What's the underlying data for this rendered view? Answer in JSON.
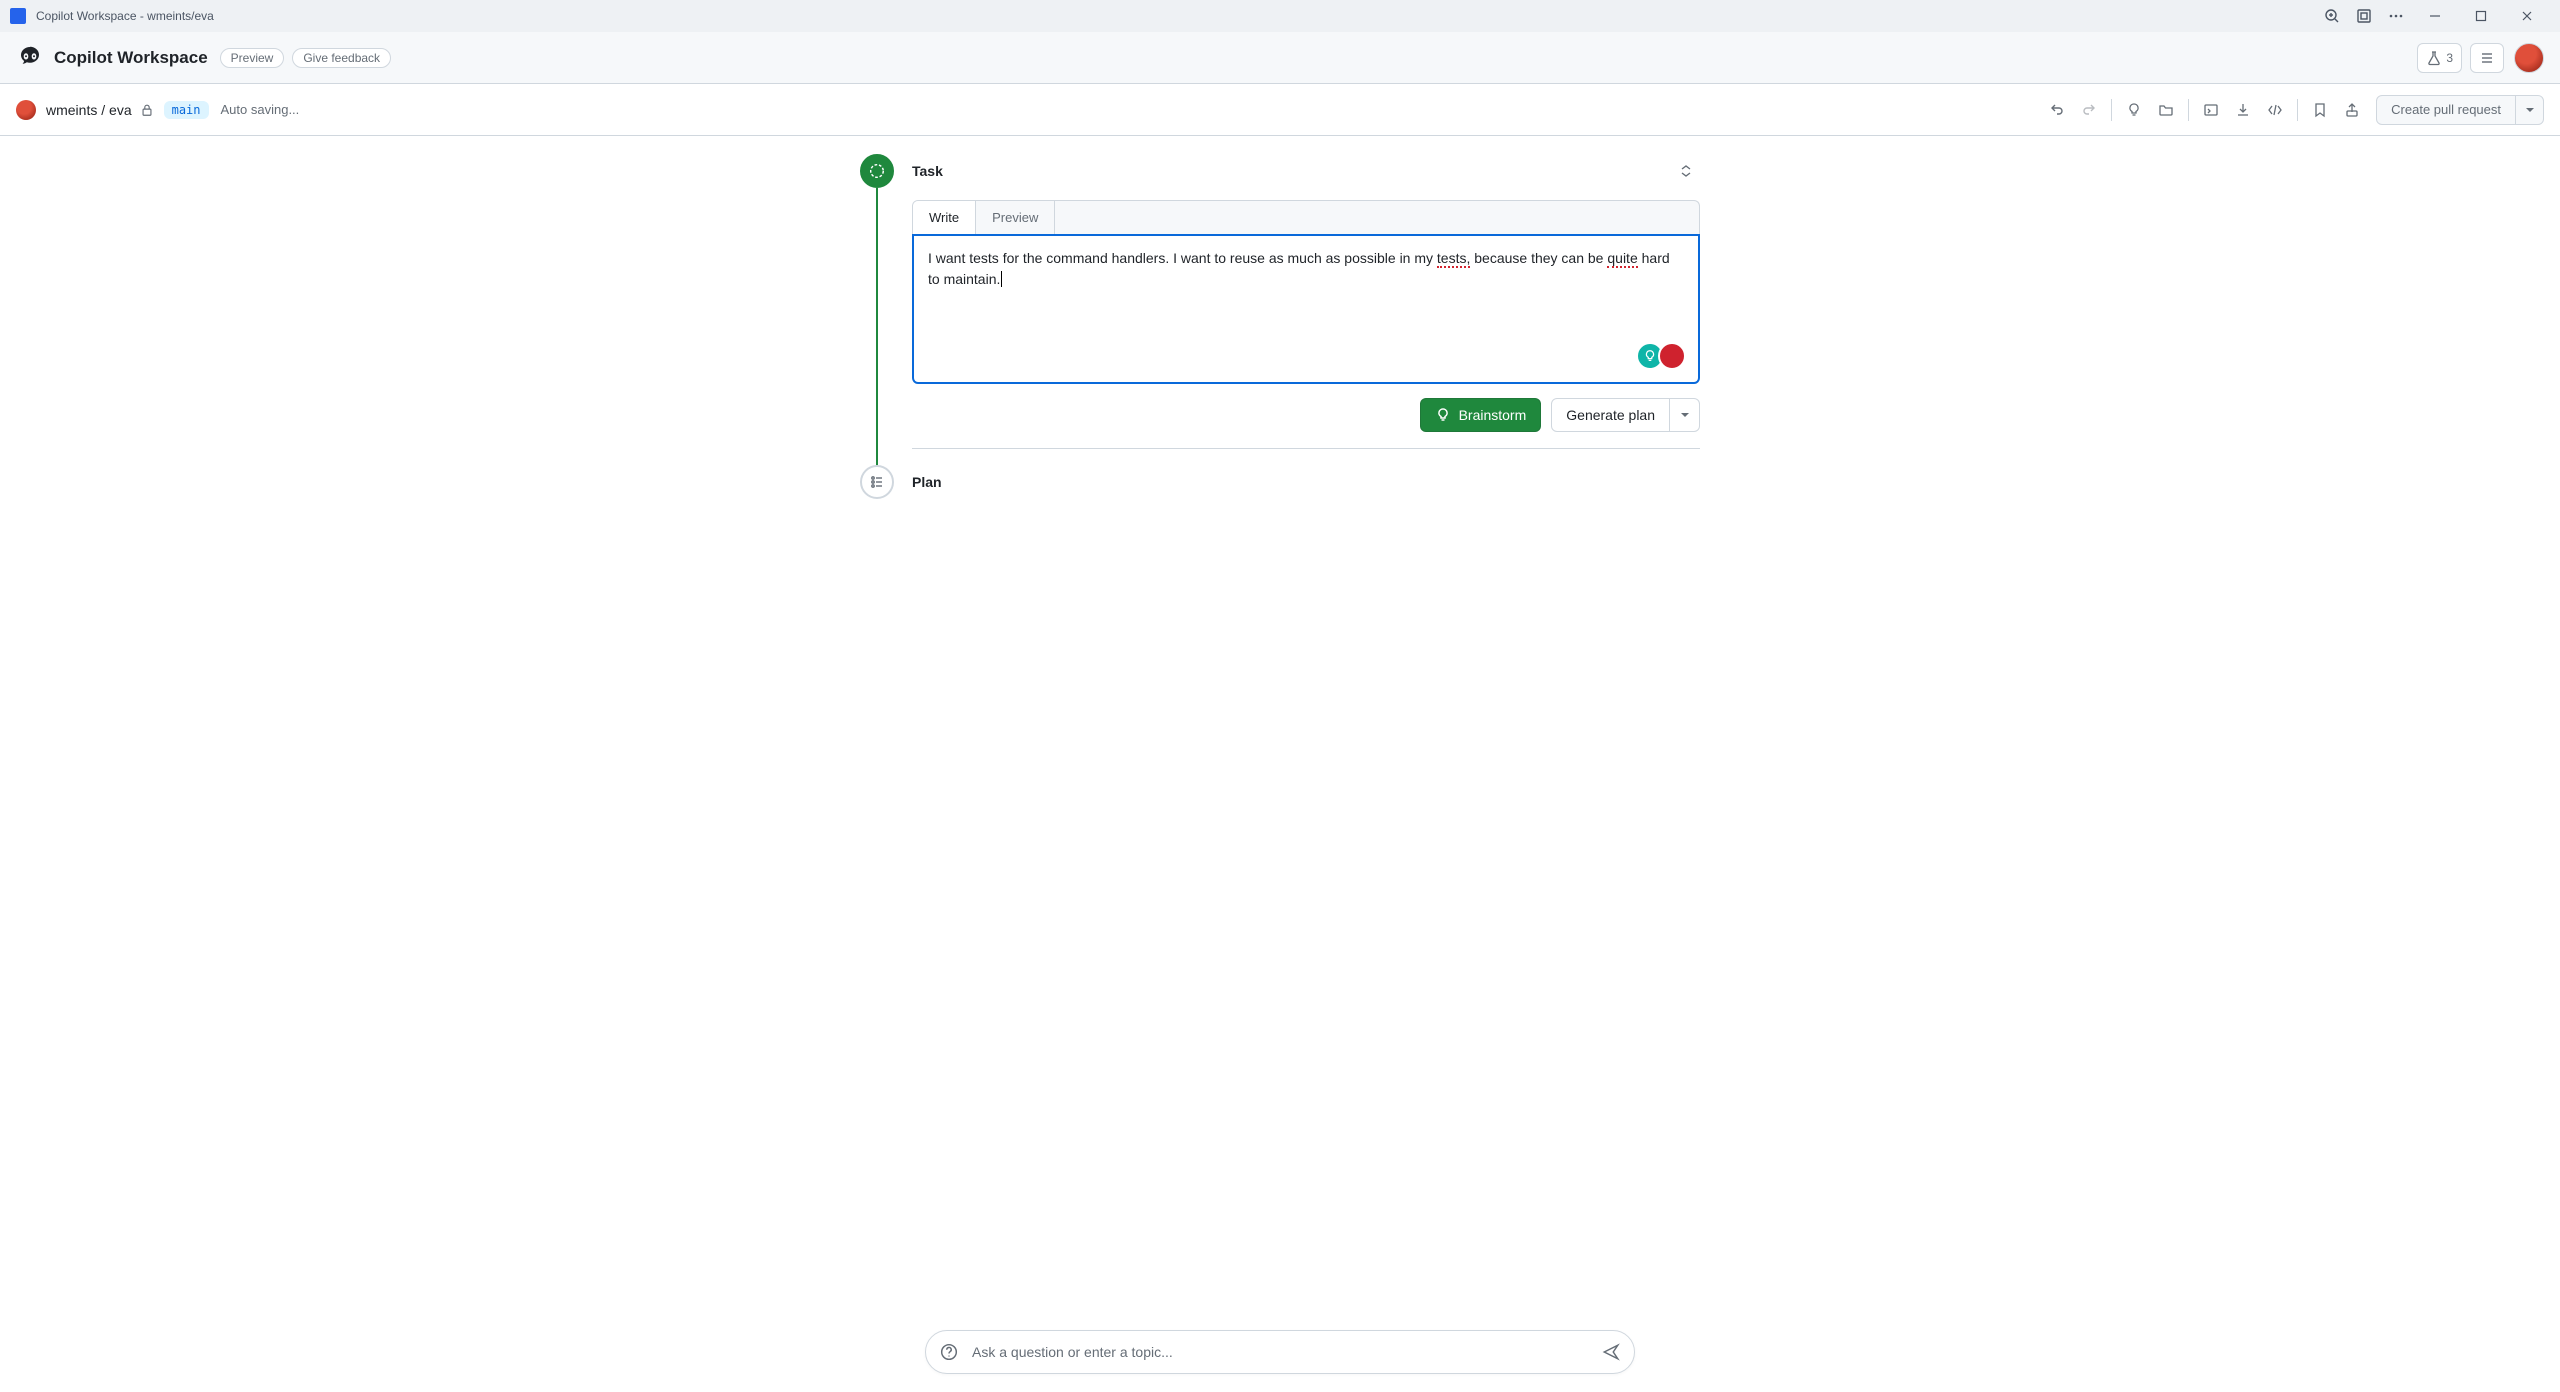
{
  "titlebar": {
    "title": "Copilot Workspace - wmeints/eva"
  },
  "header": {
    "brand": "Copilot Workspace",
    "preview_label": "Preview",
    "feedback_label": "Give feedback",
    "beaker_count": "3"
  },
  "subheader": {
    "repo_owner": "wmeints",
    "repo_sep": " / ",
    "repo_name": "eva",
    "branch": "main",
    "saving": "Auto saving...",
    "create_pr": "Create pull request"
  },
  "task": {
    "title": "Task",
    "tabs": {
      "write": "Write",
      "preview": "Preview"
    },
    "text_before": "I want tests for the command handlers. I want to reuse as much as possible in my ",
    "text_sq1": "tests,",
    "text_mid": " because they can be ",
    "text_sq2": "quite",
    "text_after": " hard to maintain.",
    "brainstorm": "Brainstorm",
    "generate_plan": "Generate plan"
  },
  "plan": {
    "title": "Plan"
  },
  "chat": {
    "placeholder": "Ask a question or enter a topic..."
  }
}
